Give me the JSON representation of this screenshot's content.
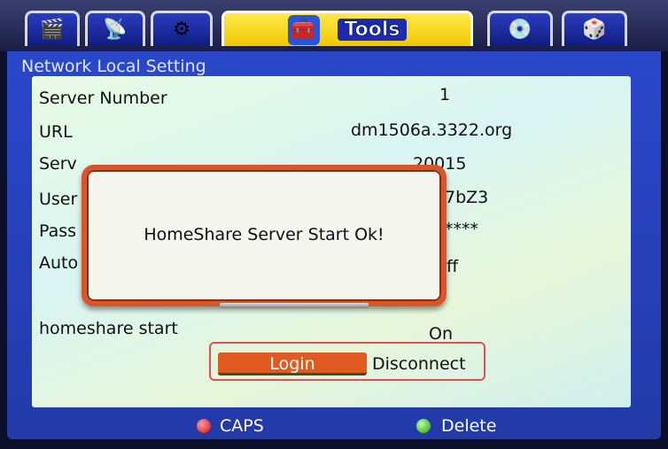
{
  "tabs": [
    {
      "icon": "film-icon",
      "glyph": "🎬"
    },
    {
      "icon": "satellite-icon",
      "glyph": "📡"
    },
    {
      "icon": "gears-icon",
      "glyph": "⚙"
    },
    {
      "icon": "toolbox-icon",
      "glyph": "🧰",
      "label": "Tools"
    },
    {
      "icon": "disc-icon",
      "glyph": "💿"
    },
    {
      "icon": "dice-icon",
      "glyph": "🎲"
    }
  ],
  "panel_title": "Network Local Setting",
  "rows": [
    {
      "label": "Server Number",
      "value": "1"
    },
    {
      "label": "URL",
      "value": "dm1506a.3322.org"
    },
    {
      "label": "Serv",
      "value": "20015"
    },
    {
      "label": "User",
      "value": "7bZ3"
    },
    {
      "label": "Pass",
      "value": "****"
    },
    {
      "label": "Auto",
      "value": "ff"
    },
    {
      "label": "homeshare start",
      "value": "On"
    }
  ],
  "buttons": {
    "login": "Login",
    "disconnect": "Disconnect"
  },
  "footer": {
    "caps": "CAPS",
    "delete": "Delete"
  },
  "modal": {
    "message": "HomeShare Server Start Ok!"
  }
}
